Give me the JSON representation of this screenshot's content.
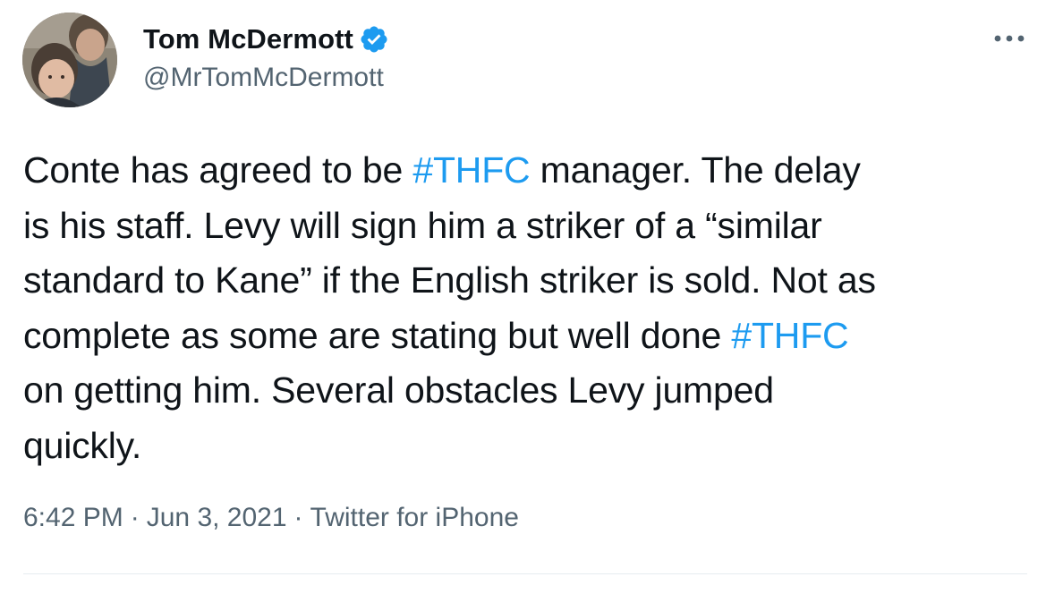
{
  "user": {
    "display_name": "Tom McDermott",
    "handle": "@MrTomMcDermott",
    "verified": true
  },
  "tweet": {
    "segments": [
      {
        "text": "Conte has agreed to be ",
        "hashtag": false
      },
      {
        "text": "#THFC",
        "hashtag": true
      },
      {
        "text": " manager. The delay\nis his staff. Levy will sign him a striker of a “similar\nstandard to Kane” if the English striker is sold. Not as\ncomplete as some are stating but well done ",
        "hashtag": false
      },
      {
        "text": "#THFC",
        "hashtag": true
      },
      {
        "text": "\non getting him. Several obstacles Levy jumped\nquickly.",
        "hashtag": false
      }
    ]
  },
  "meta": {
    "time": "6:42 PM",
    "separator": "·",
    "date": "Jun 3, 2021",
    "source": "Twitter for iPhone"
  },
  "icons": {
    "verified": "verified-badge-icon",
    "more": "more-dots-icon"
  },
  "colors": {
    "link": "#1d9bf0",
    "text": "#0f1419",
    "secondary": "#536471",
    "divider": "#e6ecf0"
  }
}
